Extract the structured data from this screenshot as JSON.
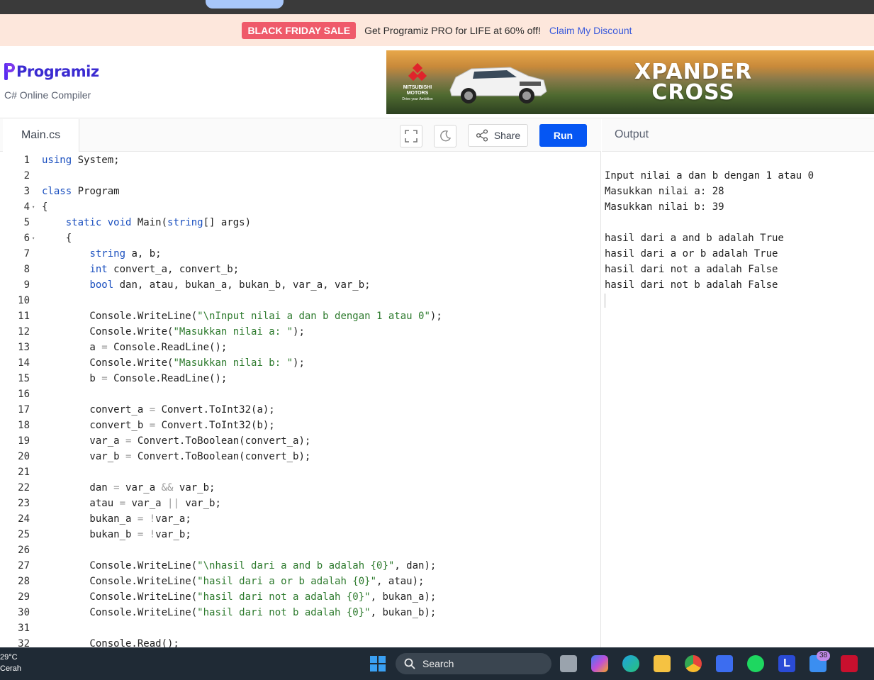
{
  "promo": {
    "badge": "BLACK FRIDAY SALE",
    "text": "Get Programiz PRO for LIFE at 60% off!",
    "link": "Claim My Discount"
  },
  "header": {
    "logo": "Programiz",
    "subtitle": "C# Online Compiler"
  },
  "ad": {
    "brand_line1": "MITSUBISHI",
    "brand_line2": "MOTORS",
    "brand_tagline": "Drive your Ambition",
    "title_line1": "XPANDER",
    "title_line2": "CROSS"
  },
  "editor": {
    "file_tab": "Main.cs",
    "share_label": "Share",
    "run_label": "Run",
    "lines": [
      {
        "n": "1",
        "fold": "",
        "html": "<span class=\"kw\">using</span> System;"
      },
      {
        "n": "2",
        "fold": "",
        "html": ""
      },
      {
        "n": "3",
        "fold": "",
        "html": "<span class=\"kw\">class</span> Program"
      },
      {
        "n": "4",
        "fold": "▾",
        "html": "{"
      },
      {
        "n": "5",
        "fold": "",
        "html": "    <span class=\"kw\">static</span> <span class=\"kw\">void</span> Main(<span class=\"kw\">string</span>[] args)"
      },
      {
        "n": "6",
        "fold": "▾",
        "html": "    {"
      },
      {
        "n": "7",
        "fold": "",
        "html": "        <span class=\"kw\">string</span> a, b;"
      },
      {
        "n": "8",
        "fold": "",
        "html": "        <span class=\"kw\">int</span> convert_a, convert_b;"
      },
      {
        "n": "9",
        "fold": "",
        "html": "        <span class=\"kw\">bool</span> dan, atau, bukan_a, bukan_b, var_a, var_b;"
      },
      {
        "n": "10",
        "fold": "",
        "html": ""
      },
      {
        "n": "11",
        "fold": "",
        "html": "        Console.WriteLine(<span class=\"str\">\"\\nInput nilai a dan b dengan 1 atau 0\"</span>);"
      },
      {
        "n": "12",
        "fold": "",
        "html": "        Console.Write(<span class=\"str\">\"Masukkan nilai a: \"</span>);"
      },
      {
        "n": "13",
        "fold": "",
        "html": "        a <span class=\"op\">=</span> Console.ReadLine();"
      },
      {
        "n": "14",
        "fold": "",
        "html": "        Console.Write(<span class=\"str\">\"Masukkan nilai b: \"</span>);"
      },
      {
        "n": "15",
        "fold": "",
        "html": "        b <span class=\"op\">=</span> Console.ReadLine();"
      },
      {
        "n": "16",
        "fold": "",
        "html": ""
      },
      {
        "n": "17",
        "fold": "",
        "html": "        convert_a <span class=\"op\">=</span> Convert.ToInt32(a);"
      },
      {
        "n": "18",
        "fold": "",
        "html": "        convert_b <span class=\"op\">=</span> Convert.ToInt32(b);"
      },
      {
        "n": "19",
        "fold": "",
        "html": "        var_a <span class=\"op\">=</span> Convert.ToBoolean(convert_a);"
      },
      {
        "n": "20",
        "fold": "",
        "html": "        var_b <span class=\"op\">=</span> Convert.ToBoolean(convert_b);"
      },
      {
        "n": "21",
        "fold": "",
        "html": ""
      },
      {
        "n": "22",
        "fold": "",
        "html": "        dan <span class=\"op\">=</span> var_a <span class=\"op\">&amp;&amp;</span> var_b;"
      },
      {
        "n": "23",
        "fold": "",
        "html": "        atau <span class=\"op\">=</span> var_a <span class=\"op\">||</span> var_b;"
      },
      {
        "n": "24",
        "fold": "",
        "html": "        bukan_a <span class=\"op\">=</span> <span class=\"op\">!</span>var_a;"
      },
      {
        "n": "25",
        "fold": "",
        "html": "        bukan_b <span class=\"op\">=</span> <span class=\"op\">!</span>var_b;"
      },
      {
        "n": "26",
        "fold": "",
        "html": ""
      },
      {
        "n": "27",
        "fold": "",
        "html": "        Console.WriteLine(<span class=\"str\">\"\\nhasil dari a and b adalah {0}\"</span>, dan);"
      },
      {
        "n": "28",
        "fold": "",
        "html": "        Console.WriteLine(<span class=\"str\">\"hasil dari a or b adalah {0}\"</span>, atau);"
      },
      {
        "n": "29",
        "fold": "",
        "html": "        Console.WriteLine(<span class=\"str\">\"hasil dari not a adalah {0}\"</span>, bukan_a);"
      },
      {
        "n": "30",
        "fold": "",
        "html": "        Console.WriteLine(<span class=\"str\">\"hasil dari not b adalah {0}\"</span>, bukan_b);"
      },
      {
        "n": "31",
        "fold": "",
        "html": ""
      },
      {
        "n": "32",
        "fold": "",
        "html": "        Console.Read();"
      }
    ]
  },
  "output": {
    "title": "Output",
    "lines": [
      "Input nilai a dan b dengan 1 atau 0",
      "Masukkan nilai a: 28",
      "Masukkan nilai b: 39",
      "",
      "hasil dari a and b adalah True",
      "hasil dari a or b adalah True",
      "hasil dari not a adalah False",
      "hasil dari not b adalah False"
    ]
  },
  "taskbar": {
    "temperature": "29°C",
    "condition": "Cerah",
    "search_label": "Search",
    "notification_count": "38"
  }
}
